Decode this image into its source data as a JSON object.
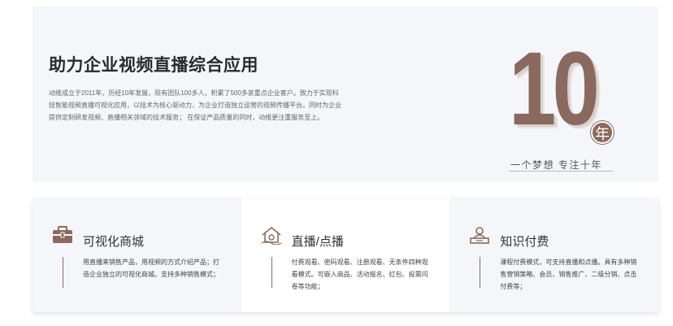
{
  "hero": {
    "title": "助力企业视频直播综合应用",
    "description": "动维成立于2011年，历经10年发展，现有团队100多人，积累了500多家重点企业客户。致力于实现科技智能视频直播可视化应用，以技术为核心驱动力，为企业打造独立运营的视频传播平台。同时为企业提供定制研发视频、直播相关领域的技术服务； 在保证产品质量的同时，动维更注重服务至上。"
  },
  "badge": {
    "number": "10",
    "year_label": "年",
    "slogan": "一个梦想 专注十年"
  },
  "features": [
    {
      "icon": "briefcase-icon",
      "title": "可视化商城",
      "description": "用直播来销售产品，用视频的方式介绍产品；打造企业独立的可视化商城。支持多种销售模式；"
    },
    {
      "icon": "house-icon",
      "title": "直播/点播",
      "description": "付费观看、密码观看、注册观看、无条件四种观看模式。可嵌入商品、活动报名、红包、投票问卷等功能；"
    },
    {
      "icon": "presenter-icon",
      "title": "知识付费",
      "description": "课程付费模式，可支持直播和点播。具有多种销售营销策略、会员、销售推广、二级分销、点击付费等；"
    }
  ],
  "colors": {
    "accent": "#8a6a5e",
    "hero_bg": "#f5f6fa"
  }
}
